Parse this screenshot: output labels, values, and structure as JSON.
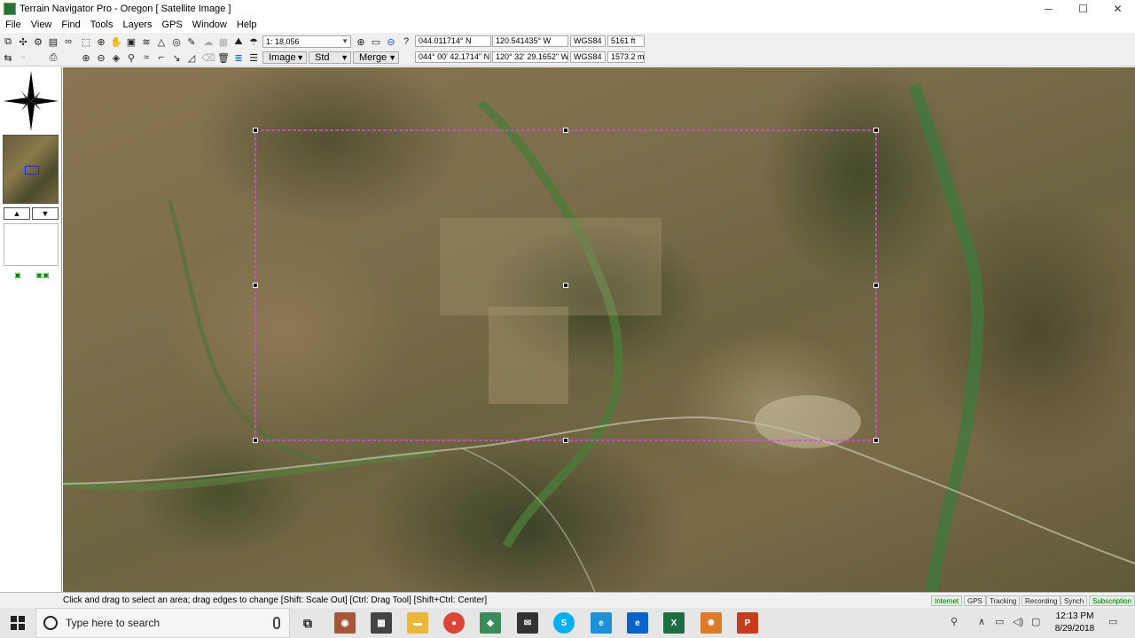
{
  "window": {
    "title": "Terrain Navigator Pro - Oregon [ Satellite Image ]",
    "controls": {
      "minimize": "─",
      "maximize": "☐",
      "close": "✕"
    }
  },
  "menu": [
    "File",
    "View",
    "Find",
    "Tools",
    "Layers",
    "GPS",
    "Window",
    "Help"
  ],
  "toolbar": {
    "scale": "1: 18,056",
    "lat_decimal": "044.011714° N",
    "lon_decimal": "120.541435° W",
    "datum_1": "WGS84",
    "elev_ft": "5161 ft",
    "lat_dms": "044° 00' 42.1714\" N",
    "lon_dms": "120° 32' 29.1652\" W",
    "datum_2": "WGS84",
    "elev_m": "1573.2 m",
    "image_mode": "Image",
    "std_mode": "Std",
    "merge_mode": "Merge"
  },
  "leftpanel": {
    "up_arrow": "▲",
    "down_arrow": "▼"
  },
  "status": {
    "hint": "Click and drag to select an area; drag edges to change [Shift: Scale Out] [Ctrl: Drag Tool] [Shift+Ctrl: Center]",
    "indicators": [
      "Internet",
      "GPS",
      "Tracking",
      "Recording",
      "Synch",
      "Subscription"
    ],
    "active": [
      "Internet",
      "Subscription"
    ]
  },
  "taskbar": {
    "search_placeholder": "Type here to search",
    "time": "12:13 PM",
    "date": "8/29/2018"
  },
  "colors": {
    "selection": "#d050d0",
    "accent_green": "#1a8a1a"
  }
}
